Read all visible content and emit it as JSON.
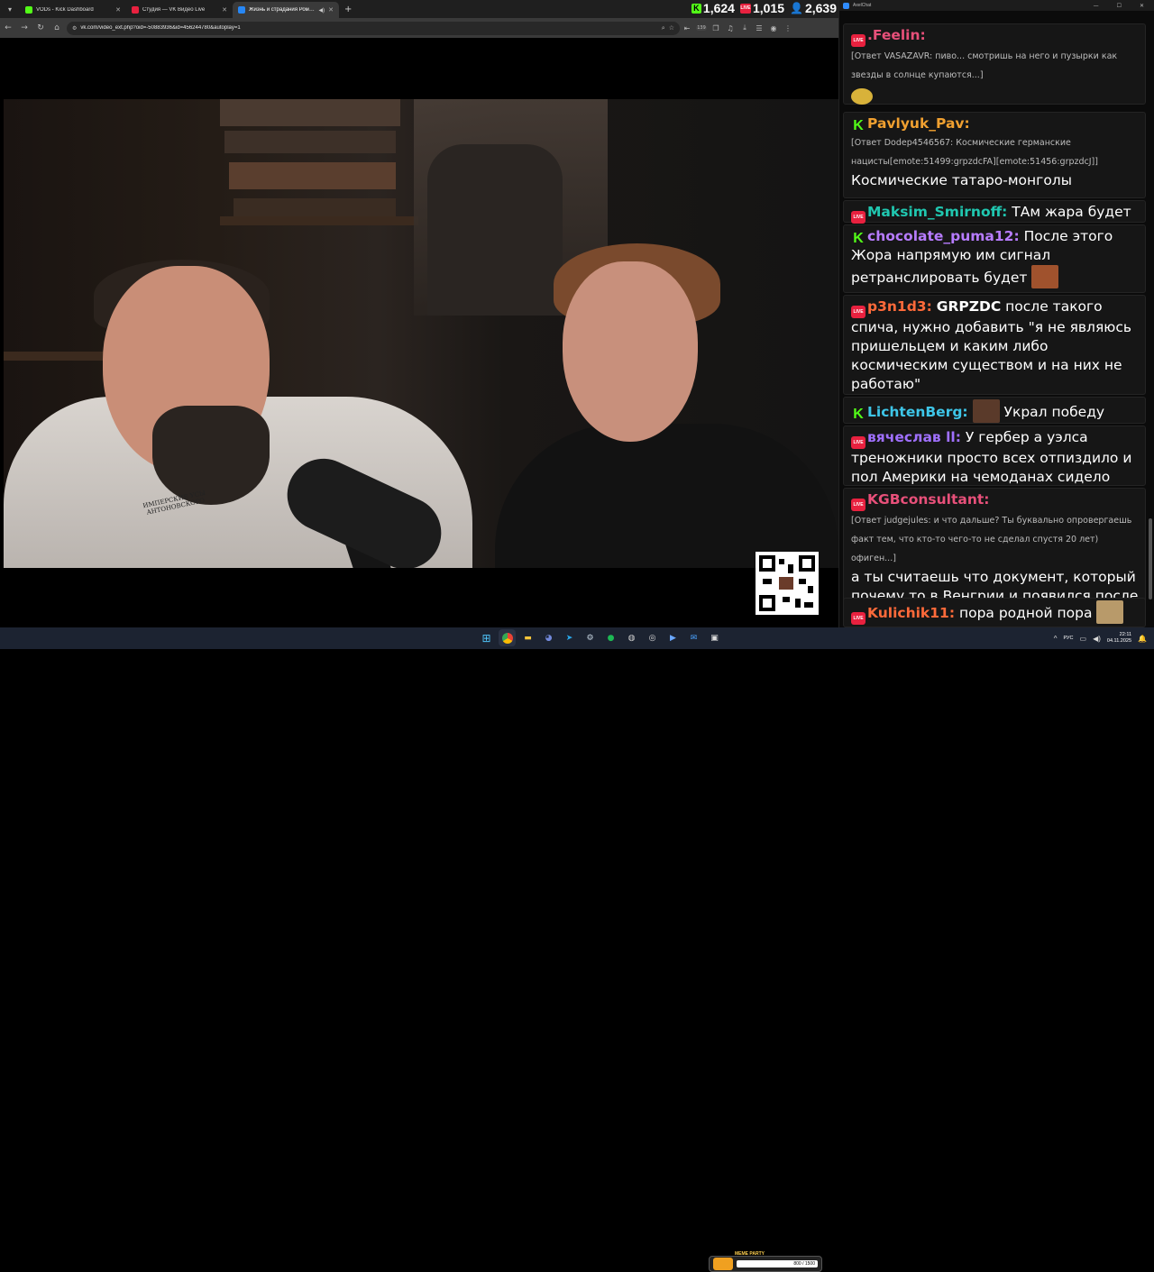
{
  "browser": {
    "tabs": [
      {
        "label": "VODs - Kick Dashboard",
        "color": "#53fc18",
        "active": false
      },
      {
        "label": "Студия — VK Видео Live",
        "color": "#e8213f",
        "active": false
      },
      {
        "label": "Жизнь и страдания Романа...",
        "color": "#2787f5",
        "active": true
      }
    ],
    "url": "vk.com/video_ext.php?oid=-50883936&id=456244780&autoplay=1",
    "extension_badge": "139"
  },
  "stats": {
    "kick_viewers": "1,624",
    "vk_viewers": "1,015",
    "total_viewers": "2,639",
    "vk_badge": "LIVE"
  },
  "video": {
    "shirt_text": "ИМПЕРСКИЕ УСЫ АНТОНОВСКОГО"
  },
  "chat": {
    "app_title": "AxelChat",
    "messages": [
      {
        "platform": "vk",
        "nick": ".Feelin:",
        "nick_color": "#e8507a",
        "reply": "[Ответ VASAZAVR: пиво... смотришь на него и пузырки как звезды в солнце купаются...]",
        "text": "",
        "emote": "#d8b23a"
      },
      {
        "platform": "kick",
        "nick": "Pavlyuk_Pav:",
        "nick_color": "#f0a030",
        "reply": "[Ответ Dodep4546567: Космические германские нацисты[emote:51499:grpzdcFA][emote:51456:grpzdcJ]]",
        "text": "Космические татаро-монголы"
      },
      {
        "platform": "vk",
        "nick": "Maksim_Smirnoff:",
        "nick_color": "#20c7b0",
        "text": "ТАм жара будет"
      },
      {
        "platform": "kick",
        "nick": "chocolate_puma12:",
        "nick_color": "#b77cff",
        "text": "После этого Жора напрямую им сигнал ретранслировать будет"
      },
      {
        "platform": "vk",
        "nick": "p3n1d3:",
        "nick_color": "#ff6a3a",
        "mention": "GRPZDC",
        "text": "после такого спича, нужно добавить \"я не являюсь пришельцем и каким либо космическим существом и на них не работаю\""
      },
      {
        "platform": "kick",
        "nick": "LichtenBerg:",
        "nick_color": "#3ec6e8",
        "text": "Украл победу"
      },
      {
        "platform": "vk",
        "nick": "вячеслав ll:",
        "nick_color": "#a070ff",
        "text": "У гербер а уэлса треножники просто всех отпиздило и пол Америки на чемоданах сидело"
      },
      {
        "platform": "vk",
        "nick": "KGBconsultant:",
        "nick_color": "#e8507a",
        "reply": "[Ответ judgejules: и что дальше? Ты буквально опровергаешь факт тем, что кто-то чего-то не сделал спустя 20 лет) офиген...]",
        "text": "а ты считаешь что документ, который почему то в Венгрии и появился после всех событий настоящим."
      },
      {
        "platform": "vk",
        "nick": "Kulichik11:",
        "nick_color": "#ff6a3a",
        "text": "пора родной пора"
      }
    ]
  },
  "taskbar": {
    "meme_title": "MEME PARTY",
    "meme_progress": "800 / 1500",
    "lang": "РУС",
    "time": "22:11",
    "date": "04.11.2025"
  }
}
